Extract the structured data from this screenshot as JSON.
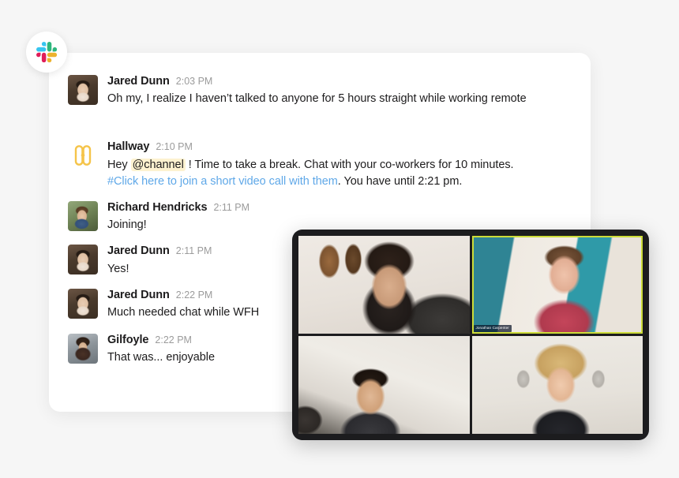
{
  "branding": {
    "slack_logo_name": "slack-logo",
    "hallway_logo_name": "hallway-logo",
    "slack_colors": {
      "blue": "#36c5f0",
      "green": "#2eb67d",
      "red": "#e01e5a",
      "yellow": "#ecb22e"
    },
    "hallway_color": "#f5c44a",
    "link_color": "#5fa8e8",
    "mention_highlight": "#fdf2d0",
    "active_speaker_color": "#cddc39"
  },
  "chat": {
    "messages": [
      {
        "author": "Jared Dunn",
        "time": "2:03 PM",
        "avatar": "avatar-jared-dunn",
        "text": "Oh my, I realize I haven’t talked to anyone for 5 hours straight while working remote"
      },
      {
        "author": "Hallway",
        "time": "2:10 PM",
        "avatar": "hallway-logo",
        "line1_a": "Hey ",
        "line1_mention": "@channel",
        "line1_b": " ! Time to take a break. Chat with your co-workers for 10 minutes.",
        "line2_link": "#Click here to join a short video call with them",
        "line2_tail": ". You have until 2:21 pm."
      },
      {
        "author": "Richard Hendricks",
        "time": "2:11 PM",
        "avatar": "avatar-richard-hendricks",
        "text": "Joining!"
      },
      {
        "author": "Jared Dunn",
        "time": "2:11 PM",
        "avatar": "avatar-jared-dunn",
        "text": "Yes!"
      },
      {
        "author": "Jared Dunn",
        "time": "2:22 PM",
        "avatar": "avatar-jared-dunn",
        "text": "Much needed chat while WFH"
      },
      {
        "author": "Gilfoyle",
        "time": "2:22 PM",
        "avatar": "avatar-gilfoyle",
        "text": "That was... enjoyable"
      }
    ]
  },
  "video_call": {
    "tiles": [
      {
        "position": "top-left",
        "name_label": "",
        "active_speaker": false
      },
      {
        "position": "top-right",
        "name_label": "Jonathan Carpenter",
        "active_speaker": true
      },
      {
        "position": "bottom-left",
        "name_label": "",
        "active_speaker": false
      },
      {
        "position": "bottom-right",
        "name_label": "",
        "active_speaker": false
      }
    ]
  }
}
